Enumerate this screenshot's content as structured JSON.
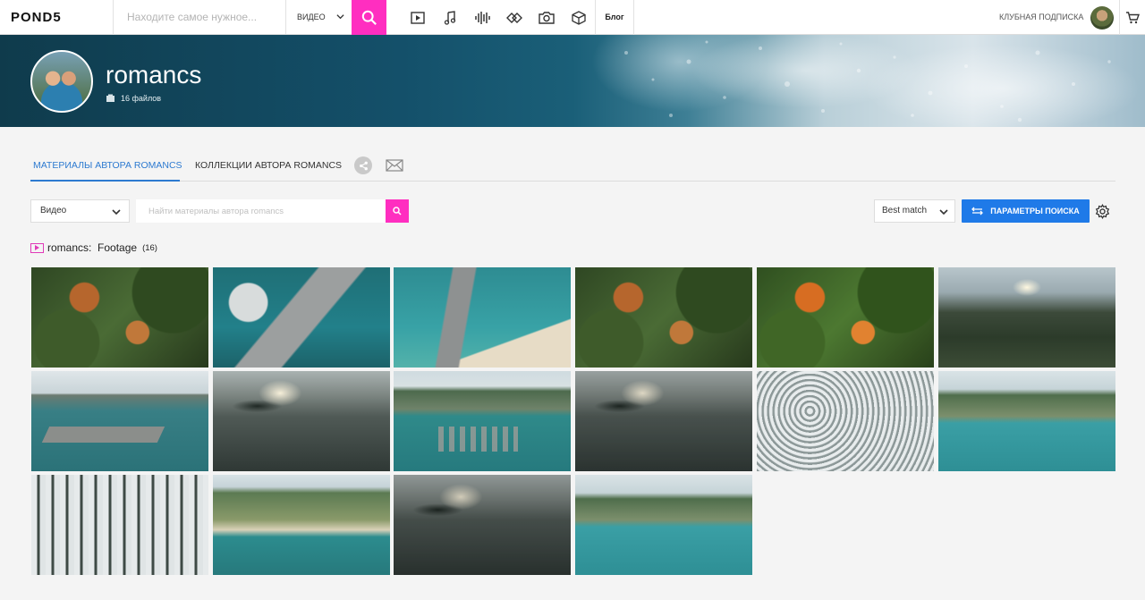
{
  "topbar": {
    "logo": "POND5",
    "search_placeholder": "Находите самое нужное...",
    "search_type": "ВИДЕО",
    "blog": "Блог",
    "club": "КЛУБНАЯ ПОДПИСКА",
    "media_icons": [
      "video-icon",
      "music-note-icon",
      "sound-wave-icon",
      "after-effects-icon",
      "camera-icon",
      "cube-icon"
    ]
  },
  "banner": {
    "author_name": "romancs",
    "file_count": "16 файлов"
  },
  "tabs": {
    "materials": "МАТЕРИАЛЫ АВТОРА ROMANCS",
    "collections": "КОЛЛЕКЦИИ АВТОРА ROMANCS"
  },
  "filters": {
    "media_type": "Видео",
    "search_placeholder": "Найти материалы автора romancs",
    "sort": "Best match",
    "params_button": "ПАРАМЕТРЫ ПОИСКА"
  },
  "section": {
    "title": "romancs:  Footage",
    "count": "(16)"
  },
  "colors": {
    "accent_pink": "#ff2ec0",
    "accent_blue": "#1f7ae8",
    "tab_active": "#2d7ad0"
  }
}
